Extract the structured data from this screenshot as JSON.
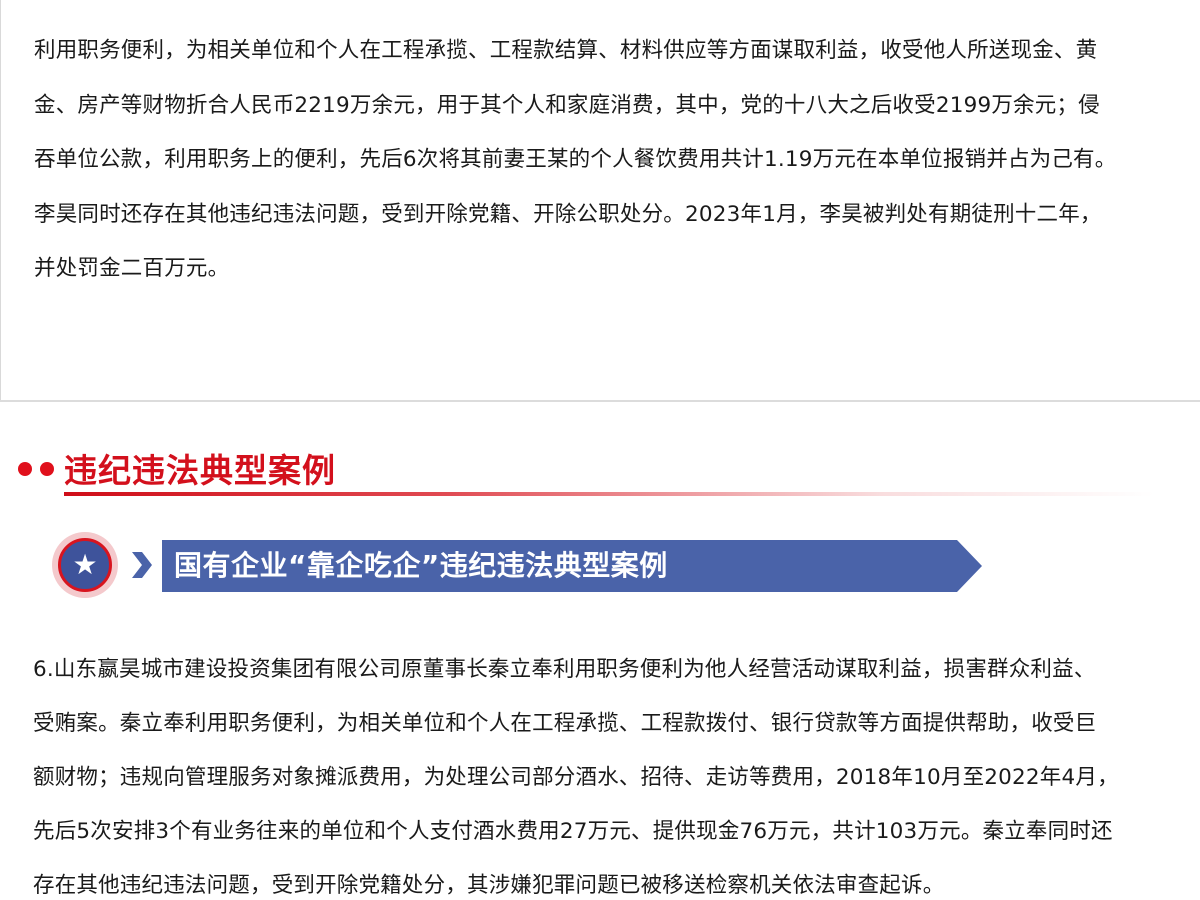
{
  "slide_top": {
    "lines": [
      "利用职务便利，为相关单位和个人在工程承揽、工程款结算、材料供应等方面谋取利益，收受他人所送现金、黄",
      "金、房产等财物折合人民币2219万余元，用于其个人和家庭消费，其中，党的十八大之后收受2199万余元；侵",
      "吞单位公款，利用职务上的便利，先后6次将其前妻王某的个人餐饮费用共计1.19万元在本单位报销并占为己有。",
      "李昊同时还存在其他违纪违法问题，受到开除党籍、开除公职处分。2023年1月，李昊被判处有期徒刑十二年，",
      "并处罚金二百万元。"
    ]
  },
  "section": {
    "title": "违纪违法典型案例"
  },
  "banner": {
    "icon": "star-icon",
    "title": "国有企业“靠企吃企”违纪违法典型案例"
  },
  "case": {
    "lines": [
      "6.山东嬴昊城市建设投资集团有限公司原董事长秦立奉利用职务便利为他人经营活动谋取利益，损害群众利益、",
      "受贿案。秦立奉利用职务便利，为相关单位和个人在工程承揽、工程款拨付、银行贷款等方面提供帮助，收受巨",
      "额财物；违规向管理服务对象摊派费用，为处理公司部分酒水、招待、走访等费用，2018年10月至2022年4月，",
      "先后5次安排3个有业务往来的单位和个人支付酒水费用27万元、提供现金76万元，共计103万元。秦立奉同时还",
      "存在其他违纪违法问题，受到开除党籍处分，其涉嫌犯罪问题已被移送检察机关依法审查起诉。"
    ]
  },
  "colors": {
    "accent_red": "#d3101c",
    "banner_blue": "#4a63a9",
    "badge_blue": "#3e539b",
    "badge_ring": "#f4c9cc"
  }
}
